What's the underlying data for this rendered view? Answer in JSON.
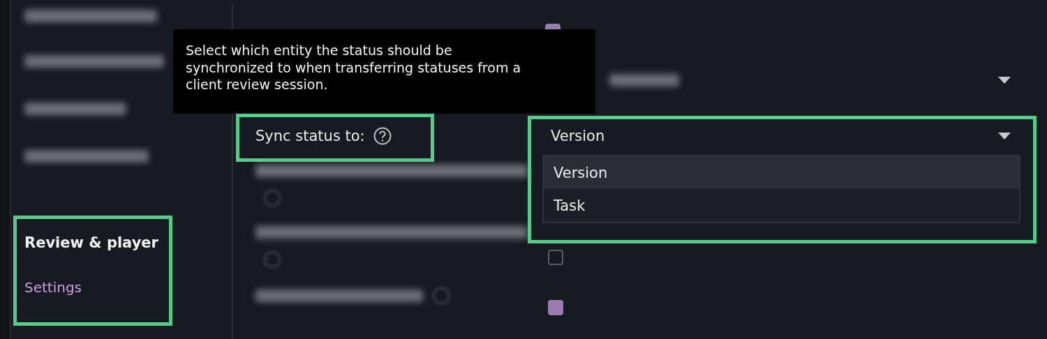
{
  "tooltip": {
    "text": "Select which entity the status should be\nsynchronized to when transferring statuses from a\nclient review session."
  },
  "sidebar": {
    "section": "Review & player",
    "items": [
      {
        "label": "Settings",
        "selected": true
      }
    ]
  },
  "sync_setting": {
    "label": "Sync status to:",
    "value": "Version",
    "options": [
      {
        "label": "Version",
        "selected": true
      },
      {
        "label": "Task",
        "selected": false
      }
    ]
  },
  "blurred_rows": [
    {
      "kind": "checkbox",
      "checked": true
    },
    {
      "kind": "select"
    },
    {
      "kind": "sync"
    },
    {
      "kind": "help_below"
    },
    {
      "kind": "checkbox_help_below",
      "checked": false
    },
    {
      "kind": "checkbox_help_inline",
      "checked": true
    }
  ]
}
